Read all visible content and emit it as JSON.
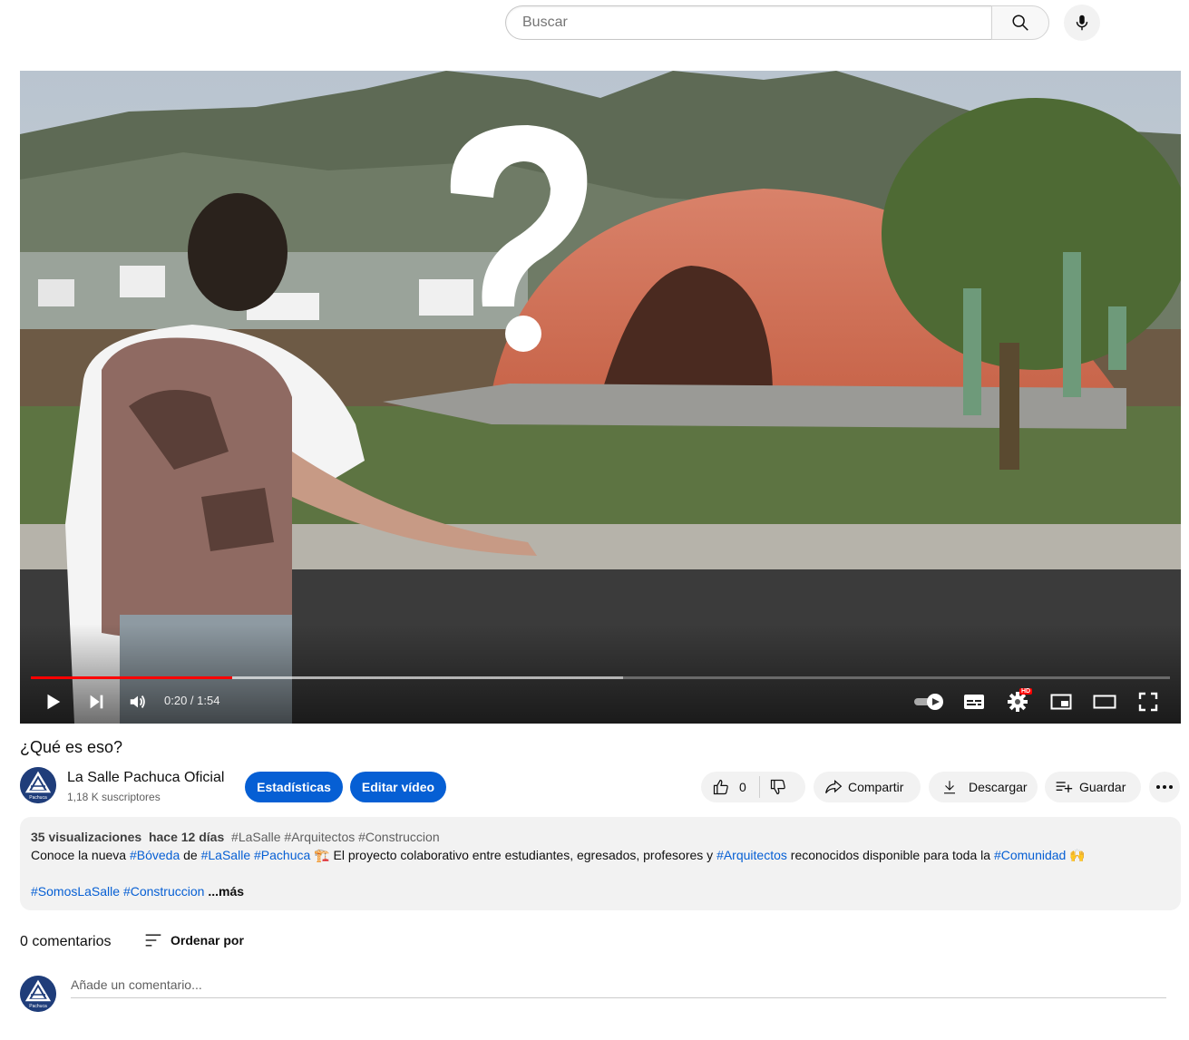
{
  "search": {
    "placeholder": "Buscar"
  },
  "player": {
    "time_display": "0:20 / 1:54",
    "progress_fraction": 0.177,
    "buffered_fraction": 0.52,
    "settings_badge": "HD",
    "accent": "#ff0000"
  },
  "video": {
    "title": "¿Qué es eso?",
    "channel_name": "La Salle Pachuca Oficial",
    "subscribers": "1,18 K suscriptores",
    "avatar_label": "Pachuca",
    "stats_label": "Estadísticas",
    "edit_label": "Editar vídeo",
    "likes": "0",
    "share_label": "Compartir",
    "download_label": "Descargar",
    "save_label": "Guardar"
  },
  "description": {
    "views": "35 visualizaciones",
    "date": "hace 12 días",
    "tags": "#LaSalle #Arquitectos #Construccion",
    "line1": {
      "t1": "Conoce la nueva ",
      "h1": "#Bóveda",
      "t2": " de ",
      "h2": "#LaSalle",
      "t3": " ",
      "h3": "#Pachuca",
      "t4": " 🏗️ El proyecto colaborativo entre estudiantes, egresados, profesores y ",
      "h4": "#Arquitectos",
      "t5": " reconocidos disponible para toda la ",
      "h5": "#Comunidad",
      "t6": " 🙌"
    },
    "line2": {
      "h1": "#SomosLaSalle",
      "h2": "#Construccion"
    },
    "more": "...más"
  },
  "comments": {
    "count": "0 comentarios",
    "sort_label": "Ordenar por",
    "placeholder": "Añade un comentario..."
  },
  "colors": {
    "brand_blue": "#065fd4",
    "progress_red": "#ff0000",
    "pill_bg": "#f2f2f2"
  }
}
